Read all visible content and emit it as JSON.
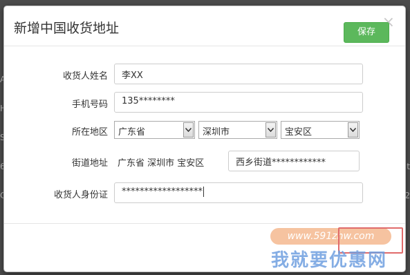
{
  "backdrop": {
    "left_fragments": [
      "A",
      "H",
      "S",
      "6",
      "C"
    ],
    "right_fragments": [
      "t",
      "2"
    ]
  },
  "dialog": {
    "title": "新增中国收货地址",
    "close_glyph": "×"
  },
  "form": {
    "recipient": {
      "label": "收货人姓名",
      "value": "李XX"
    },
    "phone": {
      "label": "手机号码",
      "value": "135********"
    },
    "region": {
      "label": "所在地区",
      "province": "广东省",
      "city": "深圳市",
      "district": "宝安区"
    },
    "street": {
      "label": "街道地址",
      "prefix": "广东省 深圳市 宝安区",
      "value": "西乡街道************"
    },
    "id_card": {
      "label": "收货人身份证",
      "value": "******************"
    }
  },
  "footer": {
    "save_label": "保存"
  },
  "watermark": {
    "url": "www.591zhw.com",
    "text": "我就要优惠网"
  }
}
